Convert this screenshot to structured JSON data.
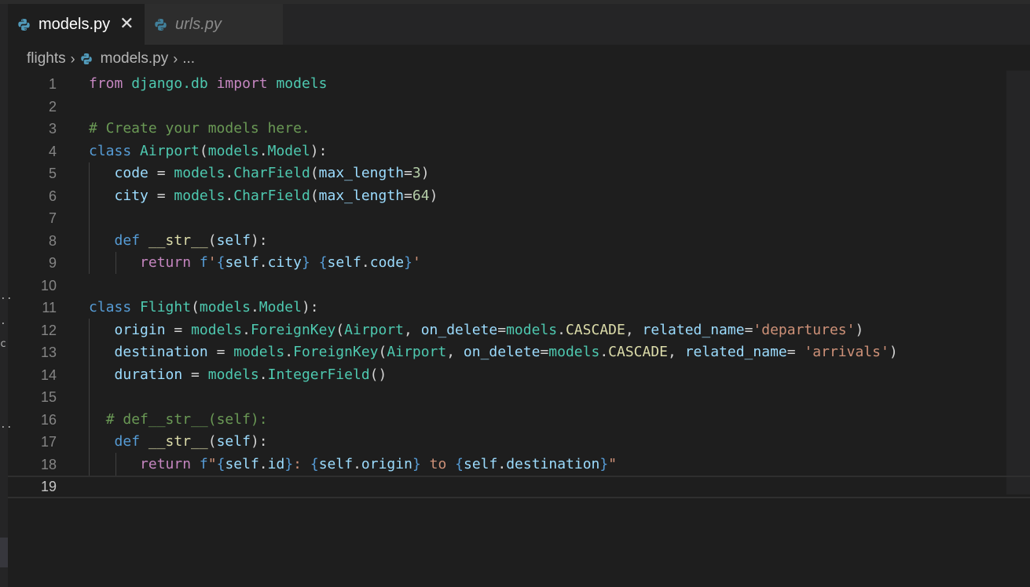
{
  "tabs": [
    {
      "label": "models.py",
      "active": true,
      "icon": "python-icon",
      "close": "✕"
    },
    {
      "label": "urls.py",
      "active": false,
      "icon": "python-icon"
    }
  ],
  "breadcrumb": {
    "folder": "flights",
    "file": "models.py",
    "ellipsis": "..."
  },
  "left_gutter_fragments": [
    "..",
    ".",
    "c",
    ".."
  ],
  "current_line": 19,
  "colors": {
    "background": "#1e1e1e",
    "keyword": "#569cd6",
    "control": "#c586c0",
    "class": "#4ec9b0",
    "function": "#dcdcaa",
    "variable": "#9cdcfe",
    "number": "#b5cea8",
    "string": "#ce9178",
    "comment": "#6a9955"
  },
  "lines": [
    {
      "n": "1",
      "tokens": [
        [
          "kw-ctrl",
          "from"
        ],
        [
          "pl",
          " "
        ],
        [
          "mod",
          "django.db"
        ],
        [
          "pl",
          " "
        ],
        [
          "kw-ctrl",
          "import"
        ],
        [
          "pl",
          " "
        ],
        [
          "mod",
          "models"
        ]
      ]
    },
    {
      "n": "2",
      "tokens": []
    },
    {
      "n": "3",
      "tokens": [
        [
          "com",
          "# Create your models here."
        ]
      ]
    },
    {
      "n": "4",
      "tokens": [
        [
          "kw",
          "class"
        ],
        [
          "pl",
          " "
        ],
        [
          "cls",
          "Airport"
        ],
        [
          "pl",
          "("
        ],
        [
          "mod",
          "models"
        ],
        [
          "pl",
          "."
        ],
        [
          "cls",
          "Model"
        ],
        [
          "pl",
          "):"
        ]
      ]
    },
    {
      "n": "5",
      "tokens": [
        [
          "pl",
          "   "
        ],
        [
          "var",
          "code"
        ],
        [
          "pl",
          " = "
        ],
        [
          "mod",
          "models"
        ],
        [
          "pl",
          "."
        ],
        [
          "cls",
          "CharField"
        ],
        [
          "pl",
          "("
        ],
        [
          "var",
          "max_length"
        ],
        [
          "pl",
          "="
        ],
        [
          "num",
          "3"
        ],
        [
          "pl",
          ")"
        ]
      ]
    },
    {
      "n": "6",
      "tokens": [
        [
          "pl",
          "   "
        ],
        [
          "var",
          "city"
        ],
        [
          "pl",
          " = "
        ],
        [
          "mod",
          "models"
        ],
        [
          "pl",
          "."
        ],
        [
          "cls",
          "CharField"
        ],
        [
          "pl",
          "("
        ],
        [
          "var",
          "max_length"
        ],
        [
          "pl",
          "="
        ],
        [
          "num",
          "64"
        ],
        [
          "pl",
          ")"
        ]
      ]
    },
    {
      "n": "7",
      "tokens": []
    },
    {
      "n": "8",
      "tokens": [
        [
          "pl",
          "   "
        ],
        [
          "kw",
          "def"
        ],
        [
          "pl",
          " "
        ],
        [
          "fn",
          "__str__"
        ],
        [
          "pl",
          "("
        ],
        [
          "var",
          "self"
        ],
        [
          "pl",
          "):"
        ]
      ]
    },
    {
      "n": "9",
      "tokens": [
        [
          "pl",
          "      "
        ],
        [
          "kw-ctrl",
          "return"
        ],
        [
          "pl",
          " "
        ],
        [
          "kw",
          "f"
        ],
        [
          "str",
          "'"
        ],
        [
          "brace",
          "{"
        ],
        [
          "var",
          "self"
        ],
        [
          "pl",
          "."
        ],
        [
          "var",
          "city"
        ],
        [
          "brace",
          "}"
        ],
        [
          "str",
          " "
        ],
        [
          "brace",
          "{"
        ],
        [
          "var",
          "self"
        ],
        [
          "pl",
          "."
        ],
        [
          "var",
          "code"
        ],
        [
          "brace",
          "}"
        ],
        [
          "str",
          "'"
        ]
      ]
    },
    {
      "n": "10",
      "tokens": []
    },
    {
      "n": "11",
      "tokens": [
        [
          "kw",
          "class"
        ],
        [
          "pl",
          " "
        ],
        [
          "cls",
          "Flight"
        ],
        [
          "pl",
          "("
        ],
        [
          "mod",
          "models"
        ],
        [
          "pl",
          "."
        ],
        [
          "cls",
          "Model"
        ],
        [
          "pl",
          "):"
        ]
      ]
    },
    {
      "n": "12",
      "tokens": [
        [
          "pl",
          "   "
        ],
        [
          "var",
          "origin"
        ],
        [
          "pl",
          " = "
        ],
        [
          "mod",
          "models"
        ],
        [
          "pl",
          "."
        ],
        [
          "cls",
          "ForeignKey"
        ],
        [
          "pl",
          "("
        ],
        [
          "cls",
          "Airport"
        ],
        [
          "pl",
          ", "
        ],
        [
          "var",
          "on_delete"
        ],
        [
          "pl",
          "="
        ],
        [
          "mod",
          "models"
        ],
        [
          "pl",
          "."
        ],
        [
          "fn",
          "CASCADE"
        ],
        [
          "pl",
          ", "
        ],
        [
          "var",
          "related_name"
        ],
        [
          "pl",
          "="
        ],
        [
          "str",
          "'departures'"
        ],
        [
          "pl",
          ")"
        ]
      ]
    },
    {
      "n": "13",
      "tokens": [
        [
          "pl",
          "   "
        ],
        [
          "var",
          "destination"
        ],
        [
          "pl",
          " = "
        ],
        [
          "mod",
          "models"
        ],
        [
          "pl",
          "."
        ],
        [
          "cls",
          "ForeignKey"
        ],
        [
          "pl",
          "("
        ],
        [
          "cls",
          "Airport"
        ],
        [
          "pl",
          ", "
        ],
        [
          "var",
          "on_delete"
        ],
        [
          "pl",
          "="
        ],
        [
          "mod",
          "models"
        ],
        [
          "pl",
          "."
        ],
        [
          "fn",
          "CASCADE"
        ],
        [
          "pl",
          ", "
        ],
        [
          "var",
          "related_name"
        ],
        [
          "pl",
          "= "
        ],
        [
          "str",
          "'arrivals'"
        ],
        [
          "pl",
          ")"
        ]
      ]
    },
    {
      "n": "14",
      "tokens": [
        [
          "pl",
          "   "
        ],
        [
          "var",
          "duration"
        ],
        [
          "pl",
          " = "
        ],
        [
          "mod",
          "models"
        ],
        [
          "pl",
          "."
        ],
        [
          "cls",
          "IntegerField"
        ],
        [
          "pl",
          "()"
        ]
      ]
    },
    {
      "n": "15",
      "tokens": []
    },
    {
      "n": "16",
      "tokens": [
        [
          "pl",
          "  "
        ],
        [
          "com",
          "# def__str__(self):"
        ]
      ]
    },
    {
      "n": "17",
      "tokens": [
        [
          "pl",
          "   "
        ],
        [
          "kw",
          "def"
        ],
        [
          "pl",
          " "
        ],
        [
          "fn",
          "__str__"
        ],
        [
          "pl",
          "("
        ],
        [
          "var",
          "self"
        ],
        [
          "pl",
          "):"
        ]
      ]
    },
    {
      "n": "18",
      "tokens": [
        [
          "pl",
          "      "
        ],
        [
          "kw-ctrl",
          "return"
        ],
        [
          "pl",
          " "
        ],
        [
          "kw",
          "f"
        ],
        [
          "str",
          "\""
        ],
        [
          "brace",
          "{"
        ],
        [
          "var",
          "self"
        ],
        [
          "pl",
          "."
        ],
        [
          "var",
          "id"
        ],
        [
          "brace",
          "}"
        ],
        [
          "str",
          ": "
        ],
        [
          "brace",
          "{"
        ],
        [
          "var",
          "self"
        ],
        [
          "pl",
          "."
        ],
        [
          "var",
          "origin"
        ],
        [
          "brace",
          "}"
        ],
        [
          "str",
          " to "
        ],
        [
          "brace",
          "{"
        ],
        [
          "var",
          "self"
        ],
        [
          "pl",
          "."
        ],
        [
          "var",
          "destination"
        ],
        [
          "brace",
          "}"
        ],
        [
          "str",
          "\""
        ]
      ]
    },
    {
      "n": "19",
      "tokens": []
    }
  ]
}
